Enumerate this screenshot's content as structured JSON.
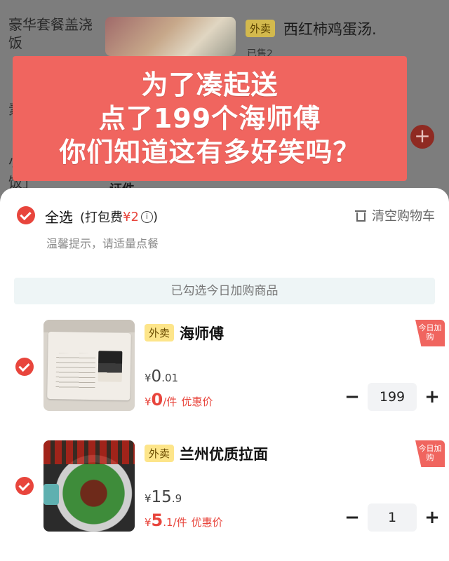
{
  "background": {
    "left_title": "豪华套餐盖浇饭",
    "tag": "外卖",
    "item_title": "西红柿鸡蛋汤.",
    "item_sub": "已售2",
    "left_2": "素",
    "left_3": "小",
    "left_4": "饭」",
    "mid_text": "证件"
  },
  "caption": {
    "line1": "为了凑起送",
    "line2": "点了199个海师傅",
    "line3": "你们知道这有多好笑吗？"
  },
  "cart": {
    "select_all": "全选",
    "pack_fee_prefix": "(打包费",
    "pack_fee_value": "¥2",
    "pack_fee_suffix": ")",
    "info_glyph": "i",
    "clear_label": "清空购物车",
    "tip": "温馨提示，请适量点餐",
    "banner": "已勾选今日加购商品",
    "items": [
      {
        "tag": "外卖",
        "name": "海师傅",
        "orig_currency": "¥",
        "orig_int": "0",
        "orig_dec": ".01",
        "deal_currency": "¥",
        "deal_int": "0",
        "deal_dec": "",
        "unit": "/件",
        "deal_note": "优惠价",
        "quantity": "199",
        "corner": "今日加购"
      },
      {
        "tag": "外卖",
        "name": "兰州优质拉面",
        "orig_currency": "¥",
        "orig_int": "15",
        "orig_dec": ".9",
        "deal_currency": "¥",
        "deal_int": "5",
        "deal_dec": ".1",
        "unit": "/件",
        "deal_note": "优惠价",
        "quantity": "1",
        "corner": "今日加购"
      }
    ],
    "minus": "−",
    "plus": "+"
  },
  "colors": {
    "accent": "#e8453c",
    "caption_bg": "#f0655f",
    "tag_bg": "#fde58a"
  }
}
